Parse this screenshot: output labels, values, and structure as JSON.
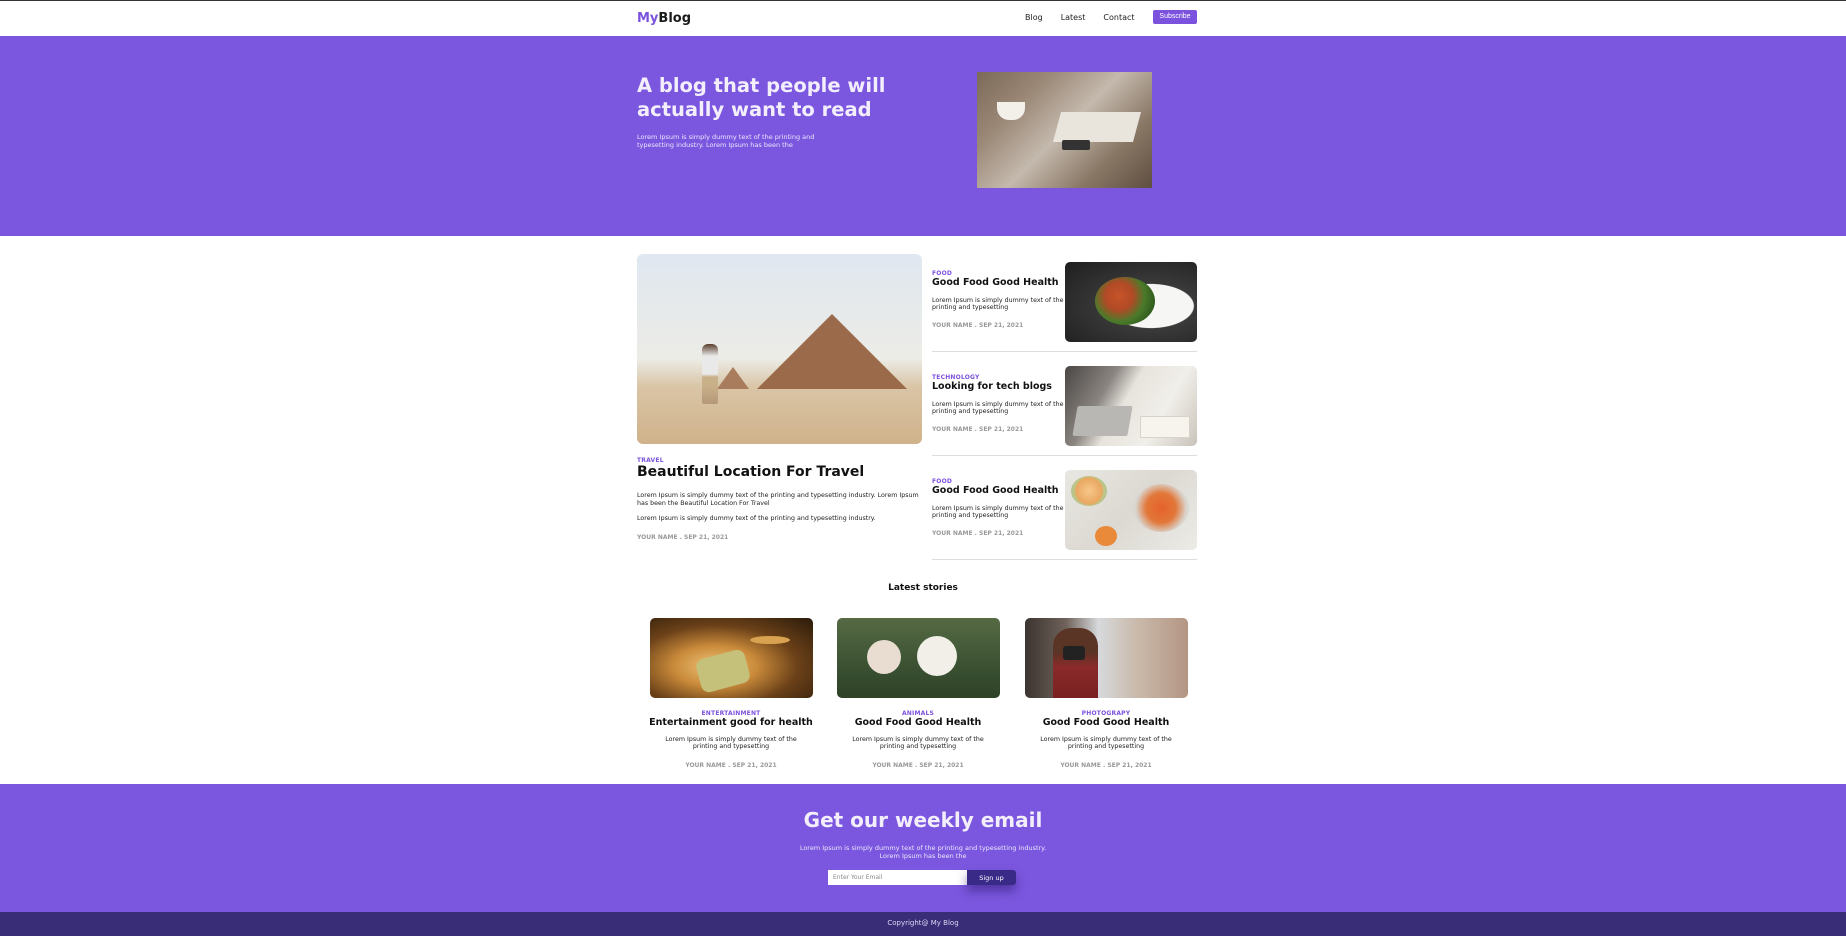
{
  "header": {
    "logo_my": "My",
    "logo_blog": "Blog",
    "nav": [
      "Blog",
      "Latest",
      "Contact"
    ],
    "subscribe_label": "Subscribe"
  },
  "hero": {
    "title": "A blog that people will actually want to read",
    "text": "Lorem Ipsum is simply dummy text of the printing and typesetting industry. Lorem Ipsum has been the"
  },
  "featured": {
    "category": "TRAVEL",
    "title": "Beautiful Location For Travel",
    "text1": "Lorem Ipsum is simply dummy text of the printing and typesetting industry. Lorem Ipsum has been the Beautiful Location For Travel",
    "text2": "Lorem Ipsum is simply dummy text of the printing and typesetting industry.",
    "meta": "YOUR NAME . SEP 21, 2021"
  },
  "side_posts": [
    {
      "category": "FOOD",
      "title": "Good Food Good Health",
      "text": "Lorem Ipsum is simply dummy text of the printing and typesetting",
      "meta": "YOUR NAME . SEP 21, 2021"
    },
    {
      "category": "TECHNOLOGY",
      "title": "Looking for tech blogs",
      "text": "Lorem Ipsum is simply dummy text of the printing and typesetting",
      "meta": "YOUR NAME . SEP 21, 2021"
    },
    {
      "category": "FOOD",
      "title": "Good Food Good Health",
      "text": "Lorem Ipsum is simply dummy text of the printing and typesetting",
      "meta": "YOUR NAME . SEP 21, 2021"
    }
  ],
  "latest": {
    "heading": "Latest stories",
    "stories": [
      {
        "category": "ENTERTAINMENT",
        "title": "Entertainment good for health",
        "text": "Lorem Ipsum is simply dummy text of the printing and typesetting",
        "meta": "YOUR NAME . SEP 21, 2021"
      },
      {
        "category": "ANIMALS",
        "title": "Good Food Good Health",
        "text": "Lorem Ipsum is simply dummy text of the printing and typesetting",
        "meta": "YOUR NAME . SEP 21, 2021"
      },
      {
        "category": "PHOTOGRAPY",
        "title": "Good Food Good Health",
        "text": "Lorem Ipsum is simply dummy text of the printing and typesetting",
        "meta": "YOUR NAME . SEP 21, 2021"
      }
    ]
  },
  "newsletter": {
    "title": "Get our weekly email",
    "text": "Lorem Ipsum is simply dummy text of the printing and typesetting industry. Lorem Ipsum has been the",
    "placeholder": "Enter Your Email",
    "button_label": "Sign up"
  },
  "footer": {
    "text": "Copyright@ My Blog"
  },
  "colors": {
    "accent": "#7b57df",
    "footer_bg": "#3a2d78",
    "button_dark": "#3a2a88"
  }
}
